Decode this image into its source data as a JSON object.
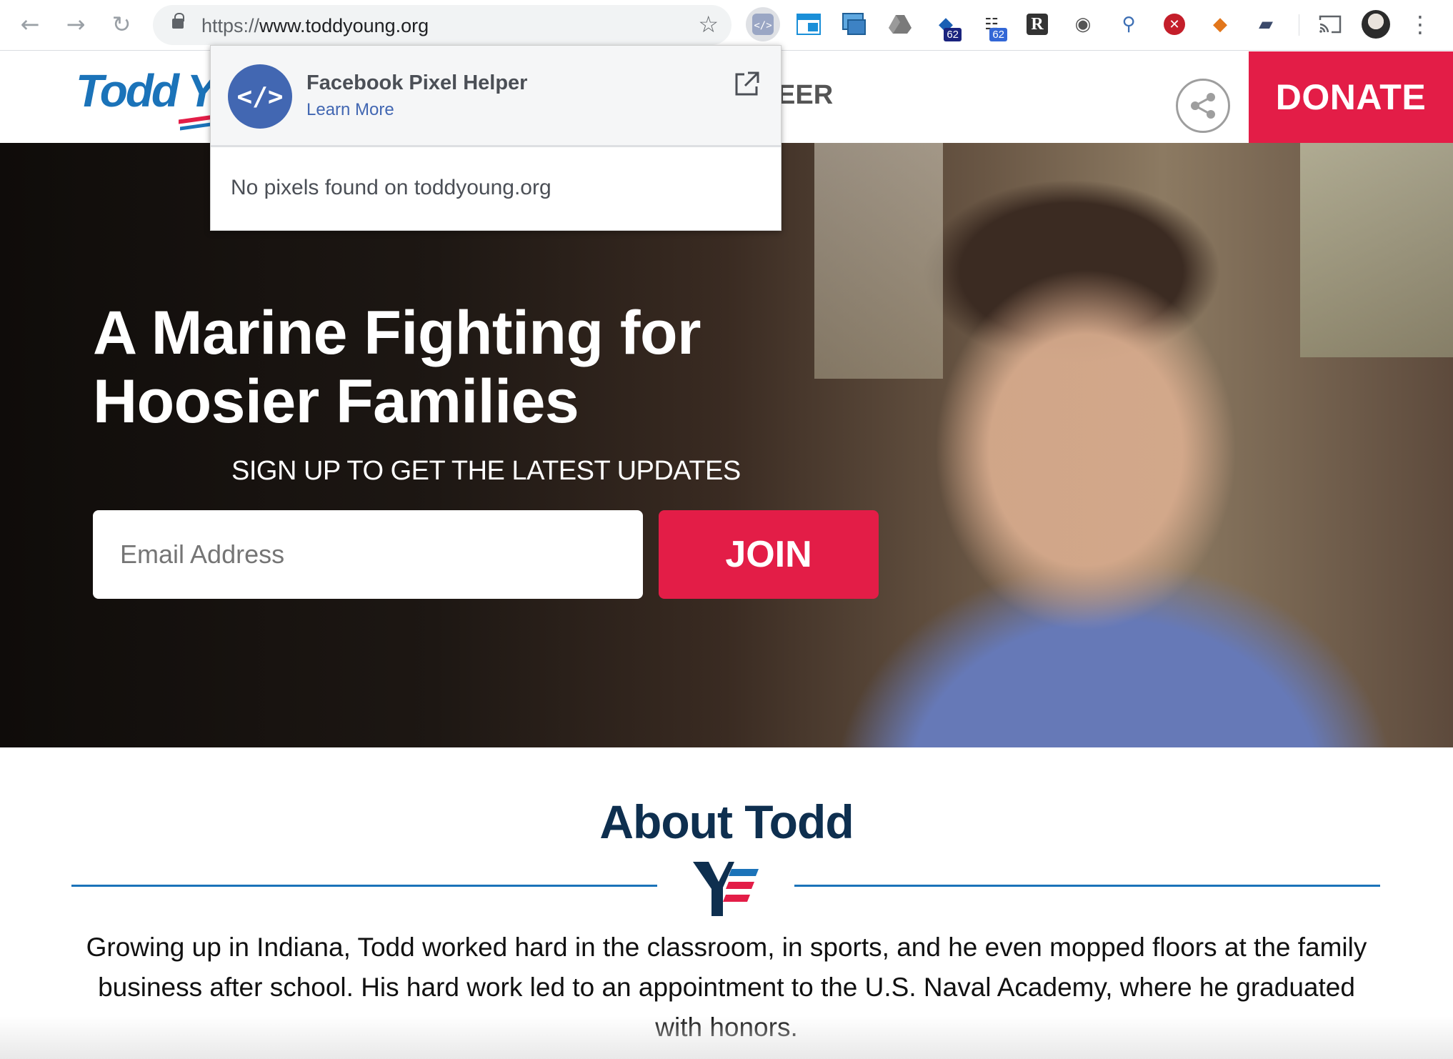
{
  "browser": {
    "back_icon": "arrow-left-icon",
    "forward_icon": "arrow-right-icon",
    "reload_icon": "reload-icon",
    "url_scheme": "https://",
    "url_host": "www.toddyoung.org",
    "extensions": [
      {
        "name": "facebook-pixel-helper-icon",
        "badge": ""
      },
      {
        "name": "window-icon",
        "badge": ""
      },
      {
        "name": "screenshot-icon",
        "badge": ""
      },
      {
        "name": "google-drive-icon",
        "badge": ""
      },
      {
        "name": "wappalyzer-icon",
        "badge": "62"
      },
      {
        "name": "tree-icon",
        "badge": "62"
      },
      {
        "name": "r-icon",
        "badge": ""
      },
      {
        "name": "eye-icon",
        "badge": ""
      },
      {
        "name": "magnifier-icon",
        "badge": ""
      },
      {
        "name": "blocker-icon",
        "badge": ""
      },
      {
        "name": "metamask-icon",
        "badge": ""
      },
      {
        "name": "cast-device-icon",
        "badge": ""
      }
    ]
  },
  "popup": {
    "title": "Facebook Pixel Helper",
    "learn_more": "Learn More",
    "message": "No pixels found on toddyoung.org",
    "icon_glyph": "</>"
  },
  "site": {
    "logo_text": "Todd Yo",
    "nav_fragment": "EER",
    "donate_label": "DONATE",
    "hero_title_line1": "A Marine Fighting for",
    "hero_title_line2": "Hoosier Families",
    "hero_subtitle": "SIGN UP TO GET THE LATEST UPDATES",
    "email_placeholder": "Email Address",
    "join_label": "JOIN",
    "about_title": "About Todd",
    "about_text": "Growing up in Indiana, Todd worked hard in the classroom, in sports, and he even mopped floors at the family business after school. His hard work led to an appointment to the U.S. Naval Academy, where he graduated with honors."
  },
  "colors": {
    "brand_red": "#e31d47",
    "brand_blue": "#1b73b9",
    "navy": "#0e2f4f",
    "facebook_blue": "#4267b2"
  }
}
